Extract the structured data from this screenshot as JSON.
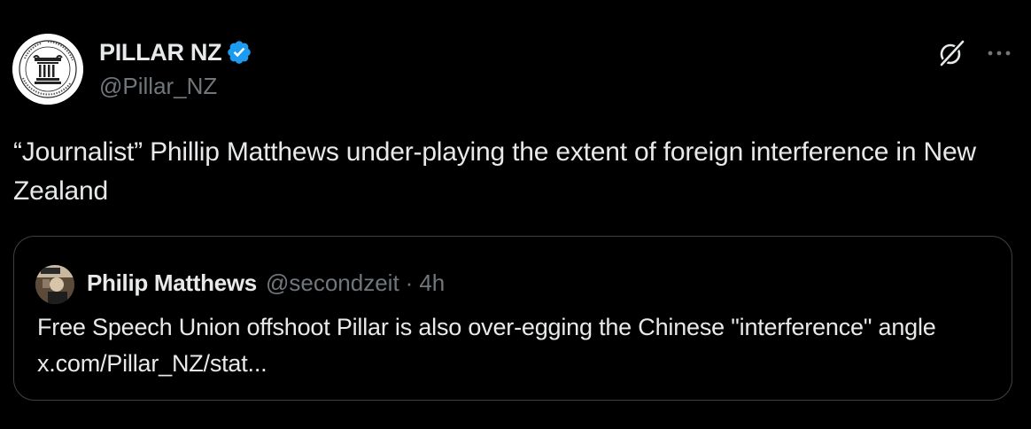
{
  "tweet": {
    "author": {
      "name": "PILLAR NZ",
      "handle": "@Pillar_NZ",
      "avatar_icon": "pillar-logo-icon",
      "verified_icon": "verified-badge-icon",
      "verified_color": "#1d9bf0"
    },
    "actions": {
      "grok_icon": "grok-icon",
      "more_icon": "more-options-icon"
    },
    "text": "“Journalist” Phillip Matthews under-playing the extent of foreign interference in New Zealand"
  },
  "quote": {
    "author_name": "Philip Matthews",
    "author_handle": "@secondzeit",
    "separator": "·",
    "time": "4h",
    "avatar_icon": "profile-photo-icon",
    "text": "Free Speech Union offshoot Pillar is also over-egging the Chinese \"interference\" angle x.com/Pillar_NZ/stat..."
  },
  "colors": {
    "background": "#000000",
    "primary_text": "#e7e9ea",
    "secondary_text": "#71767b",
    "border": "#3e4144",
    "accent": "#1d9bf0"
  }
}
